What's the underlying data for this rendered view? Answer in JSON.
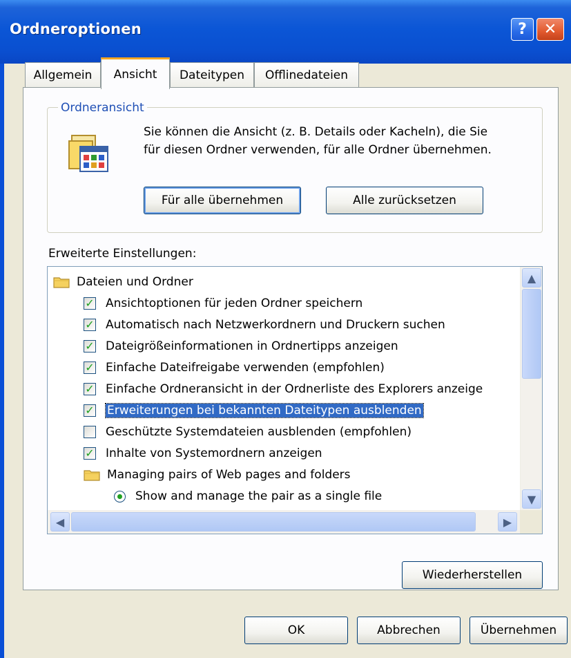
{
  "window": {
    "title": "Ordneroptionen",
    "help_glyph": "?",
    "close_glyph": "✕"
  },
  "tabs": [
    {
      "label": "Allgemein",
      "active": false
    },
    {
      "label": "Ansicht",
      "active": true
    },
    {
      "label": "Dateitypen",
      "active": false
    },
    {
      "label": "Offlinedateien",
      "active": false
    }
  ],
  "folder_view": {
    "legend": "Ordneransicht",
    "description": "Sie können die Ansicht (z. B. Details oder Kacheln), die Sie für diesen Ordner verwenden, für alle Ordner übernehmen.",
    "apply_all_label": "Für alle übernehmen",
    "reset_all_label": "Alle zurücksetzen"
  },
  "advanced": {
    "label": "Erweiterte Einstellungen:",
    "items": [
      {
        "type": "folder",
        "label": "Dateien und Ordner"
      },
      {
        "type": "checkbox",
        "checked": true,
        "label": "Ansichtoptionen für jeden Ordner speichern"
      },
      {
        "type": "checkbox",
        "checked": true,
        "label": "Automatisch nach Netzwerkordnern und Druckern suchen"
      },
      {
        "type": "checkbox",
        "checked": true,
        "label": "Dateigrößeinformationen in Ordnertipps anzeigen"
      },
      {
        "type": "checkbox",
        "checked": true,
        "label": "Einfache Dateifreigabe verwenden (empfohlen)"
      },
      {
        "type": "checkbox",
        "checked": true,
        "label": "Einfache Ordneransicht in der Ordnerliste des Explorers anzeige"
      },
      {
        "type": "checkbox",
        "checked": true,
        "selected": true,
        "label": "Erweiterungen bei bekannten Dateitypen ausblenden"
      },
      {
        "type": "checkbox",
        "checked": false,
        "label": "Geschützte Systemdateien ausblenden (empfohlen)"
      },
      {
        "type": "checkbox",
        "checked": true,
        "label": "Inhalte von Systemordnern anzeigen"
      },
      {
        "type": "folder",
        "label": "Managing pairs of Web pages and folders"
      },
      {
        "type": "radio",
        "checked": true,
        "label": "Show and manage the pair as a single file"
      }
    ],
    "restore_label": "Wiederherstellen"
  },
  "footer": {
    "ok_label": "OK",
    "cancel_label": "Abbrechen",
    "apply_label": "Übernehmen"
  },
  "colors": {
    "titlebar": "#0a4fd6",
    "dialog_bg": "#ece9d8",
    "selection": "#316ac5",
    "check": "#21a121",
    "active_tab_accent": "#f5a623"
  }
}
